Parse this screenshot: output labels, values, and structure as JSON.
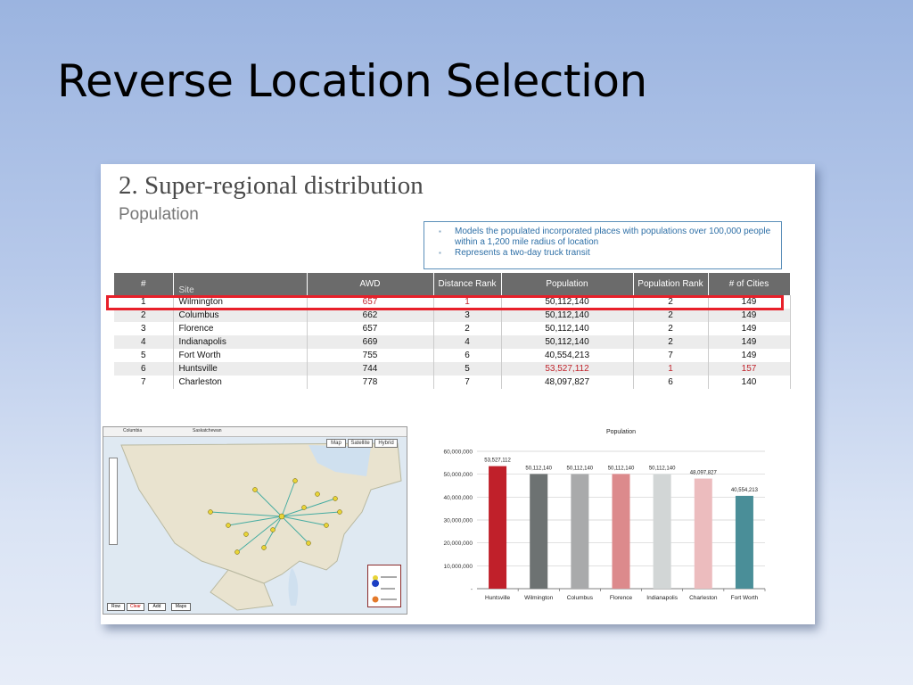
{
  "slide": {
    "title": "Reverse Location Selection"
  },
  "card": {
    "title": "2. Super-regional distribution",
    "subtitle": "Population",
    "notes": [
      "Models the populated incorporated places with populations over 100,000 people within a 1,200 mile radius of location",
      "Represents a two-day truck transit"
    ]
  },
  "table": {
    "headers": [
      "#",
      "Site",
      "AWD",
      "Distance Rank",
      "Population",
      "Population Rank",
      "# of Cities"
    ],
    "rows": [
      {
        "n": "1",
        "site": "Wilmington",
        "awd": "657",
        "drank": "1",
        "pop": "50,112,140",
        "prank": "2",
        "cities": "149"
      },
      {
        "n": "2",
        "site": "Columbus",
        "awd": "662",
        "drank": "3",
        "pop": "50,112,140",
        "prank": "2",
        "cities": "149"
      },
      {
        "n": "3",
        "site": "Florence",
        "awd": "657",
        "drank": "2",
        "pop": "50,112,140",
        "prank": "2",
        "cities": "149"
      },
      {
        "n": "4",
        "site": "Indianapolis",
        "awd": "669",
        "drank": "4",
        "pop": "50,112,140",
        "prank": "2",
        "cities": "149"
      },
      {
        "n": "5",
        "site": "Fort Worth",
        "awd": "755",
        "drank": "6",
        "pop": "40,554,213",
        "prank": "7",
        "cities": "149"
      },
      {
        "n": "6",
        "site": "Huntsville",
        "awd": "744",
        "drank": "5",
        "pop": "53,527,112",
        "prank": "1",
        "cities": "157"
      },
      {
        "n": "7",
        "site": "Charleston",
        "awd": "778",
        "drank": "7",
        "pop": "48,097,827",
        "prank": "6",
        "cities": "140"
      }
    ],
    "highlight_color": "#c0232b"
  },
  "map": {
    "buttons": [
      "Map",
      "Satellite",
      "Hybrid"
    ],
    "footer_buttons": [
      "Row",
      "Clear",
      "Add",
      "Maps"
    ],
    "label_tl": "Columbia",
    "label_top": "Saskatchewan"
  },
  "chart_data": {
    "type": "bar",
    "title": "Population",
    "categories": [
      "Huntsville",
      "Wilmington",
      "Columbus",
      "Florence",
      "Indianapolis",
      "Charleston",
      "Fort Worth"
    ],
    "values": [
      53527112,
      50112140,
      50112140,
      50112140,
      50112140,
      48097827,
      40554213
    ],
    "value_labels": [
      "53,527,112",
      "50,112,140",
      "50,112,140",
      "50,112,140",
      "50,112,140",
      "48,097,827",
      "40,554,213"
    ],
    "colors": [
      "#c0202a",
      "#6d7272",
      "#a9aaab",
      "#dc8a8c",
      "#d2d6d6",
      "#ecbcbe",
      "#4a8e98"
    ],
    "yticks": [
      "60,000,000",
      "50,000,000",
      "40,000,000",
      "30,000,000",
      "20,000,000",
      "10,000,000",
      "-"
    ],
    "ylim": [
      0,
      60000000
    ],
    "grid": true
  }
}
